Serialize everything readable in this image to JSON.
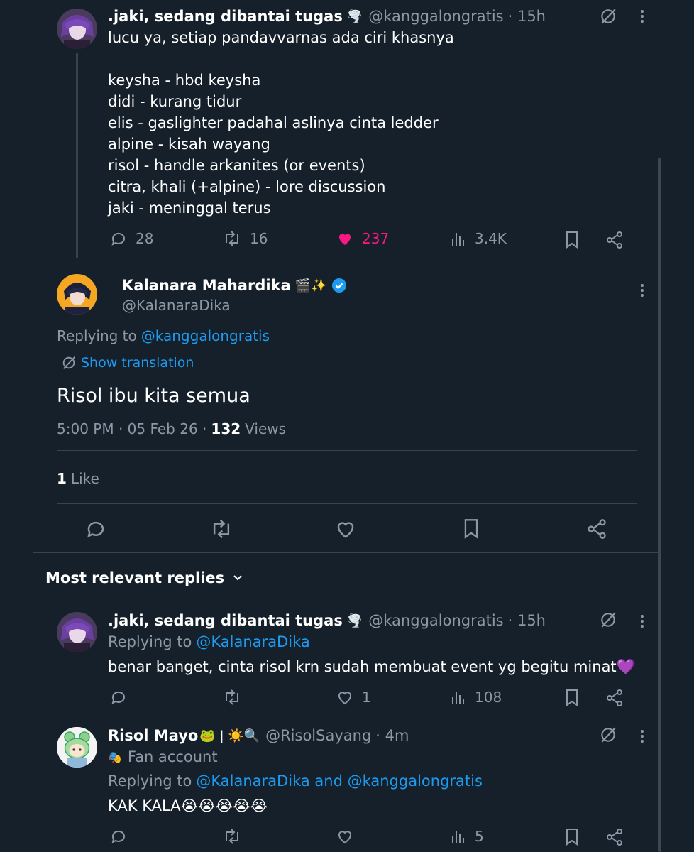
{
  "colors": {
    "background": "#15202b",
    "accent": "#1d9bf0",
    "muted": "#8b98a5",
    "like_active": "#f91880",
    "verified": "#1d9bf0"
  },
  "tweet1": {
    "name": ".jaki, sedang dibantai tugas",
    "name_emoji": "🌪️",
    "handle": "@kanggalongratis",
    "time": "· 15h",
    "lines": [
      "lucu ya, setiap pandavvarnas ada ciri khasnya",
      "",
      "keysha - hbd keysha",
      "didi - kurang tidur",
      "elis - gaslighter padahal aslinya cinta ledder",
      "alpine - kisah wayang",
      "risol - handle arkanites (or events)",
      "citra, khali (+alpine) - lore discussion",
      "jaki - meninggal terus"
    ],
    "replies": "28",
    "retweets": "16",
    "likes": "237",
    "views": "3.4K"
  },
  "main": {
    "name": "Kalanara Mahardika",
    "name_emoji": "🎬✨",
    "handle": "@KalanaraDika",
    "replying_prefix": "Replying to",
    "replying_to": "@kanggalongratis",
    "show_translation": "Show translation",
    "text": "Risol ibu kita semua",
    "timestamp": "5:00 PM · 05 Feb 26 ·",
    "views_count": "132",
    "views_label": "Views",
    "likes_count": "1",
    "likes_label": "Like"
  },
  "sort": {
    "label": "Most relevant replies"
  },
  "reply1": {
    "name": ".jaki, sedang dibantai tugas",
    "name_emoji": "🌪️",
    "handle": "@kanggalongratis",
    "time": "· 15h",
    "replying_prefix": "Replying to",
    "replying_to": "@KalanaraDika",
    "text": "benar banget, cinta risol krn sudah membuat event yg begitu minat💜",
    "replies": "",
    "retweets": "",
    "likes": "1",
    "views": "108"
  },
  "reply2": {
    "name": "Risol Mayo",
    "name_emoji": "🐸 | ☀️🔍",
    "handle": "@RisolSayang",
    "time": "· 4m",
    "label_emoji": "🎭",
    "label": "Fan account",
    "replying_prefix": "Replying to",
    "replying_to": "@KalanaraDika and @kanggalongratis",
    "text": "KAK KALA😭😭😭😭😭",
    "views": "5"
  }
}
